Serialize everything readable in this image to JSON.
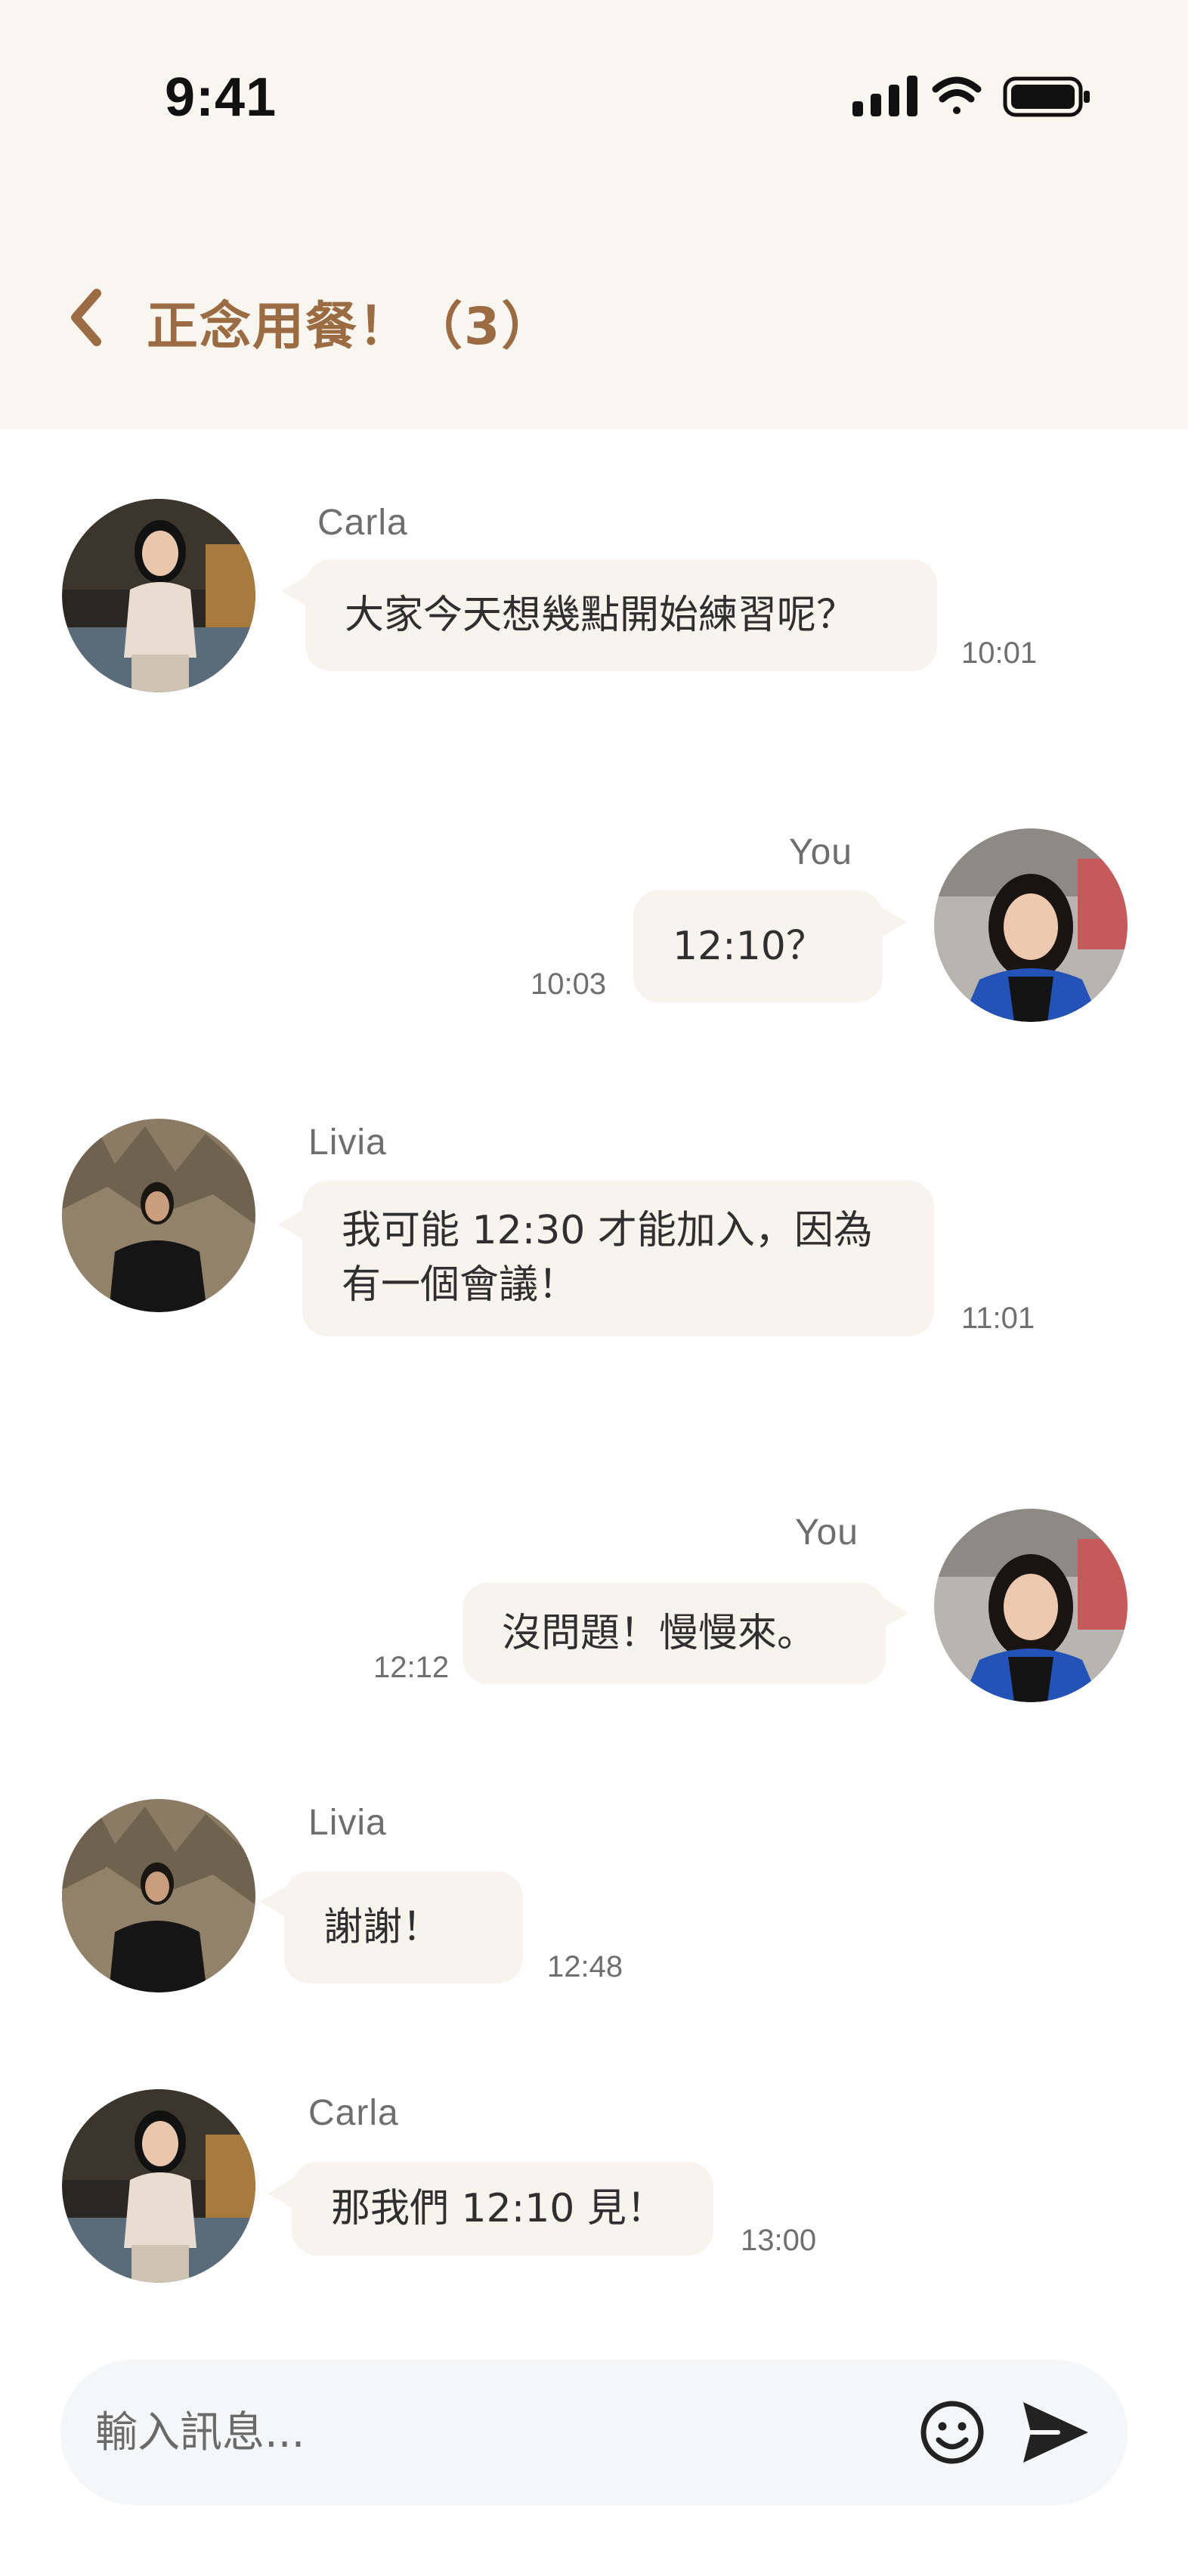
{
  "status_bar": {
    "time": "9:41"
  },
  "header": {
    "title": "正念用餐！（3）"
  },
  "messages": [
    {
      "sender": "Carla",
      "text": "大家今天想幾點開始練習呢？",
      "time": "10:01"
    },
    {
      "sender": "You",
      "text": "12:10？",
      "time": "10:03"
    },
    {
      "sender": "Livia",
      "line1": "我可能 12:30 才能加入，因為",
      "line2": "有一個會議！",
      "time": "11:01"
    },
    {
      "sender": "You",
      "text": "沒問題！慢慢來。",
      "time": "12:12"
    },
    {
      "sender": "Livia",
      "text": "謝謝！",
      "time": "12:48"
    },
    {
      "sender": "Carla",
      "text": "那我們 12:10 見！",
      "time": "13:00"
    }
  ],
  "composer": {
    "placeholder": "輸入訊息..."
  },
  "colors": {
    "header_bg": "#f9f6ef",
    "accent": "#9b6b44",
    "bubble": "#f7f4ed",
    "input_bg": "#f5f6f7"
  }
}
